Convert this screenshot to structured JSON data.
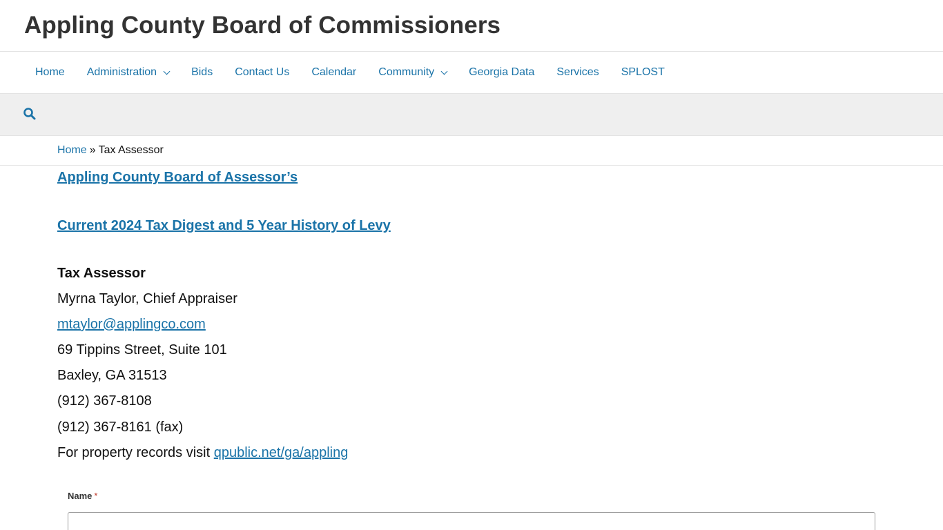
{
  "site": {
    "title": "Appling County Board of Commissioners"
  },
  "nav": {
    "items": [
      {
        "label": "Home",
        "has_dropdown": false
      },
      {
        "label": "Administration",
        "has_dropdown": true
      },
      {
        "label": "Bids",
        "has_dropdown": false
      },
      {
        "label": "Contact Us",
        "has_dropdown": false
      },
      {
        "label": "Calendar",
        "has_dropdown": false
      },
      {
        "label": "Community",
        "has_dropdown": true
      },
      {
        "label": "Georgia Data",
        "has_dropdown": false
      },
      {
        "label": "Services",
        "has_dropdown": false
      },
      {
        "label": "SPLOST",
        "has_dropdown": false
      }
    ],
    "search_icon": "search-icon"
  },
  "breadcrumb": {
    "home": "Home",
    "separator": "»",
    "current": "Tax Assessor"
  },
  "content": {
    "link_board": "Appling County Board of Assessor’s",
    "link_digest": "Current 2024 Tax Digest and 5 Year History of Levy",
    "heading": "Tax Assessor",
    "name_title": "Myrna Taylor, Chief Appraiser",
    "email": "mtaylor@applingco.com",
    "address1": "69 Tippins Street, Suite 101",
    "address2": "Baxley, GA 31513",
    "phone": "(912) 367-8108",
    "fax": "(912) 367-8161 (fax)",
    "records_prefix": "For property records visit",
    "records_link": "qpublic.net/ga/appling"
  },
  "form": {
    "name_label": "Name",
    "required_mark": "*",
    "name_value": ""
  },
  "colors": {
    "link": "#1a73a8",
    "search_bar_bg": "#efefef",
    "title": "#333333"
  }
}
